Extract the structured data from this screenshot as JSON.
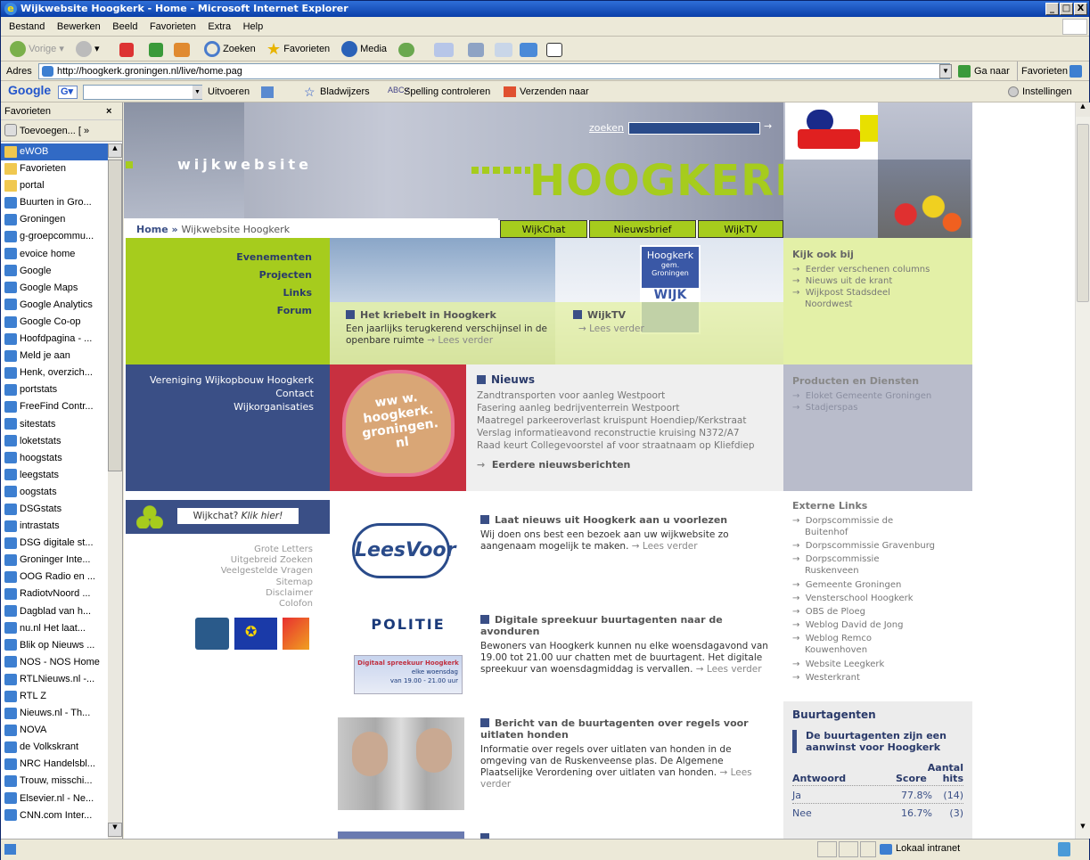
{
  "window": {
    "title": "Wijkwebsite Hoogkerk - Home - Microsoft Internet Explorer",
    "min": "_",
    "max": "□",
    "close": "X"
  },
  "menu": [
    "Bestand",
    "Bewerken",
    "Beeld",
    "Favorieten",
    "Extra",
    "Help"
  ],
  "toolbar": {
    "back": "Vorige",
    "search": "Zoeken",
    "favorites": "Favorieten",
    "media": "Media"
  },
  "address": {
    "label": "Adres",
    "url": "http://hoogkerk.groningen.nl/live/home.pag",
    "go": "Ga naar",
    "favorites": "Favorieten"
  },
  "googlebar": {
    "logo": "Google",
    "search_button": "Uitvoeren",
    "bookmarks": "Bladwijzers",
    "spell": "Spelling controleren",
    "send": "Verzenden naar",
    "settings": "Instellingen"
  },
  "sidebar": {
    "title": "Favorieten",
    "close": "×",
    "add": "Toevoegen...",
    "organize": "[ »",
    "items": [
      "eWOB",
      "Favorieten",
      "portal",
      "Buurten in Gro...",
      "Groningen",
      "g-groepcommu...",
      "evoice home",
      "Google",
      "Google Maps",
      "Google Analytics",
      "Google Co-op",
      "Hoofdpagina - ...",
      "Meld je aan",
      "Henk, overzich...",
      "portstats",
      "FreeFind Contr...",
      "sitestats",
      "loketstats",
      "hoogstats",
      "leegstats",
      "oogstats",
      "DSGstats",
      "intrastats",
      "DSG digitale st...",
      "Groninger Inte...",
      "OOG Radio en ...",
      "RadiotvNoord ...",
      "Dagblad van h...",
      "nu.nl Het laat...",
      "Blik op Nieuws ...",
      "NOS - NOS Home",
      "RTLNieuws.nl -...",
      "RTL Z",
      "Nieuws.nl - Th...",
      "NOVA",
      "de Volkskrant",
      "NRC Handelsbl...",
      "Trouw, misschi...",
      "Elsevier.nl - Ne...",
      "CNN.com Inter..."
    ]
  },
  "site": {
    "banner_wijk": "wijkwebsite",
    "banner_hoog": "HOOGKERK",
    "search_label": "zoeken",
    "breadcrumb_home": "Home",
    "breadcrumb_sep": "»",
    "breadcrumb_page": "Wijkwebsite Hoogkerk",
    "tabs": [
      "WijkChat",
      "Nieuwsbrief",
      "WijkTV"
    ],
    "mainnav": [
      "Evenementen",
      "Projecten",
      "Links",
      "Forum"
    ],
    "feature1": {
      "title": "Het kriebelt in Hoogkerk",
      "text": "Een jaarlijks terugkerend verschijnsel in de openbare ruimte",
      "more": "Lees verder"
    },
    "feature2": {
      "title": "WijkTV",
      "more": "Lees verder",
      "sign1": "Hoogkerk",
      "sign2": "gem. Groningen",
      "sign3": "WIJK"
    },
    "kijkook": {
      "title": "Kijk ook bij",
      "links": [
        "Eerder verschenen columns",
        "Nieuws uit de krant",
        "Wijkpost Stadsdeel Noordwest"
      ]
    },
    "orgnav": [
      "Vereniging Wijkopbouw Hoogkerk",
      "Contact",
      "Wijkorganisaties"
    ],
    "heart_text": [
      "ww w.",
      "hoogkerk.",
      "groningen.",
      "nl"
    ],
    "nieuws": {
      "title": "Nieuws",
      "items": [
        "Zandtransporten voor aanleg Westpoort",
        "Fasering aanleg bedrijventerrein Westpoort",
        "Maatregel parkeeroverlast kruispunt Hoendiep/Kerkstraat",
        "Verslag informatieavond reconstructie kruising N372/A7",
        "Raad keurt Collegevoorstel af voor straatnaam op Kliefdiep"
      ],
      "more": "Eerdere nieuwsberichten"
    },
    "producten": {
      "title": "Producten en Diensten",
      "links": [
        "Eloket Gemeente Groningen",
        "Stadjerspas"
      ]
    },
    "wijkchat": {
      "text": "Wijkchat? ",
      "link": "Klik hier!"
    },
    "utility": [
      "Grote Letters",
      "Uitgebreid Zoeken",
      "Veelgestelde Vragen",
      "Sitemap",
      "Disclaimer",
      "Colofon"
    ],
    "leesvoor_logo": "LeesVoor",
    "article1": {
      "title": "Laat nieuws uit Hoogkerk aan u voorlezen",
      "text": "Wij doen ons best een bezoek aan uw wijkwebsite zo aangenaam mogelijk te maken.",
      "more": "Lees verder"
    },
    "politie_logo": "POLITIE",
    "spreekuur_banner": "Digitaal spreekuur Hoogkerk",
    "spreekuur_sub": "elke woensdag",
    "spreekuur_time": "van 19.00 - 21.00 uur",
    "article2": {
      "title": "Digitale spreekuur buurtagenten naar de avonduren",
      "text": "Bewoners van Hoogkerk kunnen nu elke woensdagavond van 19.00 tot 21.00 uur chatten met de buurtagent. Het digitale spreekuur van woensdagmiddag is vervallen.",
      "more": "Lees verder"
    },
    "article3": {
      "title": "Bericht van de buurtagenten over regels voor uitlaten honden",
      "text": "Informatie over regels over uitlaten van honden in de omgeving van de Ruskenveense plas. De Algemene Plaatselijke Verordening over uitlaten van honden.",
      "more": "Lees verder"
    },
    "externe": {
      "title": "Externe Links",
      "links": [
        "Dorpscommissie de Buitenhof",
        "Dorpscommissie Gravenburg",
        "Dorpscommissie Ruskenveen",
        "Gemeente Groningen",
        "Vensterschool Hoogkerk",
        "OBS de Ploeg",
        "Weblog David de Jong",
        "Weblog Remco Kouwenhoven",
        "Website Leegkerk",
        "Westerkrant"
      ]
    },
    "poll": {
      "section": "Buurtagenten",
      "question": "De buurtagenten zijn een aanwinst voor Hoogkerk",
      "col1": "Antwoord",
      "col2": "Score",
      "col3a": "Aantal",
      "col3b": "hits",
      "rows": [
        {
          "a": "Ja",
          "s": "77.8%",
          "h": "(14)"
        },
        {
          "a": "Nee",
          "s": "16.7%",
          "h": "(3)"
        }
      ]
    }
  },
  "status": {
    "zone": "Lokaal intranet"
  },
  "colors": {
    "green": "#a6cc1d",
    "navy": "#3a4f86",
    "titlebar": "#0a3fa8"
  }
}
